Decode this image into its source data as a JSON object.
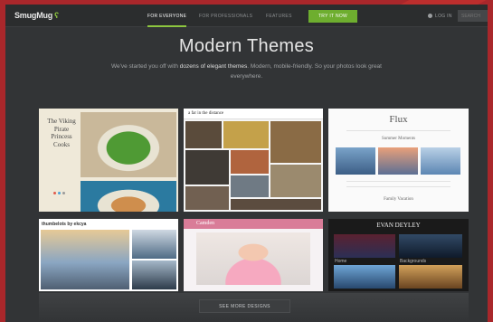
{
  "header": {
    "logo": "SmugMug",
    "logo_icon": "smugmug-face-icon",
    "nav": [
      "FOR EVERYONE",
      "FOR PROFESSIONALS",
      "FEATURES"
    ],
    "active_nav": "FOR EVERYONE",
    "try_button": "TRY IT NOW",
    "login": "LOG IN",
    "search_placeholder": "SEARCH",
    "accent_color": "#6eae2f"
  },
  "hero": {
    "title": "Modern Themes",
    "subtitle_pre": "We've started you off with ",
    "subtitle_bold": "dozens of elegant themes",
    "subtitle_post": ". Modern, mobile-friendly. So your photos look great everywhere."
  },
  "themes": [
    {
      "title": "The Viking Pirate Princess Cooks"
    },
    {
      "title": "a far in the distance"
    },
    {
      "title": "Flux",
      "sections": [
        "Summer Moments",
        "Family Vacation"
      ]
    },
    {
      "title": "thumbelots by ekcya"
    },
    {
      "title": "Camden"
    },
    {
      "title": "EVAN DEYLEY",
      "captions": [
        "Home",
        "Backgrounds"
      ]
    }
  ],
  "see_more": "SEE MORE DESIGNS"
}
